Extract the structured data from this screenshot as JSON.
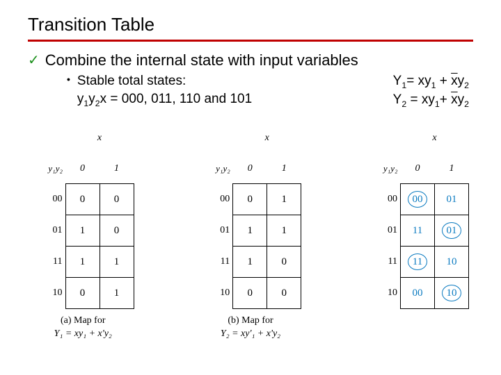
{
  "title": "Transition Table",
  "main_bullet": "Combine the internal state with input variables",
  "sub_bullet_line1": "Stable total states:",
  "sub_bullet_line2_prefix": "y",
  "sub_bullet_line2_sub1": "1",
  "sub_bullet_line2_mid": "y",
  "sub_bullet_line2_sub2": "2",
  "sub_bullet_line2_rest": "x = 000, 011, 110 and 101",
  "eq1_lhs": "Y",
  "eq1_sub": "1",
  "eq1_rhs_a": "= xy",
  "eq1_rhs_a_sub": "1",
  "eq1_plus": "+ ",
  "eq1_rhs_b_bar": "x",
  "eq1_rhs_b": "y",
  "eq1_rhs_b_sub": "2",
  "eq2_lhs": "Y",
  "eq2_sub": "2",
  "eq2_rhs_a": " = xy",
  "eq2_rhs_a_bar": "'",
  "eq2_rhs_a_sub": "1",
  "eq2_plus": "+ ",
  "eq2_rhs_b_bar": "x",
  "eq2_rhs_b": "y",
  "eq2_rhs_b_sub": "2",
  "top_var": "x",
  "side_var": "y₁y₂",
  "col0": "0",
  "col1": "1",
  "rows": [
    "00",
    "01",
    "11",
    "10"
  ],
  "mapA": {
    "r00": [
      "0",
      "0"
    ],
    "r01": [
      "1",
      "0"
    ],
    "r11": [
      "1",
      "1"
    ],
    "r10": [
      "0",
      "1"
    ]
  },
  "mapB": {
    "r00": [
      "0",
      "1"
    ],
    "r01": [
      "1",
      "1"
    ],
    "r11": [
      "1",
      "0"
    ],
    "r10": [
      "0",
      "0"
    ]
  },
  "mapC": {
    "r00": [
      "00",
      "01"
    ],
    "r01": [
      "11",
      "01"
    ],
    "r11": [
      "11",
      "10"
    ],
    "r10": [
      "00",
      "10"
    ]
  },
  "stableC": {
    "r00": [
      true,
      false
    ],
    "r01": [
      false,
      true
    ],
    "r11": [
      true,
      false
    ],
    "r10": [
      false,
      true
    ]
  },
  "captionA_l1": "(a) Map for",
  "captionA_l2": "Y₁ = xy₁ + x'y₂",
  "captionB_l1": "(b) Map for",
  "captionB_l2": "Y₂ = xy'₁ + x'y₂",
  "chart_data": [
    {
      "type": "table",
      "title": "Map for Y1 = xy1 + x'y2",
      "xlabel": "x",
      "ylabel": "y1y2",
      "categories_cols": [
        "0",
        "1"
      ],
      "categories_rows": [
        "00",
        "01",
        "11",
        "10"
      ],
      "values": [
        [
          0,
          0
        ],
        [
          1,
          0
        ],
        [
          1,
          1
        ],
        [
          0,
          1
        ]
      ]
    },
    {
      "type": "table",
      "title": "Map for Y2 = xy'1 + x'y2",
      "xlabel": "x",
      "ylabel": "y1y2",
      "categories_cols": [
        "0",
        "1"
      ],
      "categories_rows": [
        "00",
        "01",
        "11",
        "10"
      ],
      "values": [
        [
          0,
          1
        ],
        [
          1,
          1
        ],
        [
          1,
          0
        ],
        [
          0,
          0
        ]
      ]
    },
    {
      "type": "table",
      "title": "Transition table Y1Y2 (circled = stable)",
      "xlabel": "x",
      "ylabel": "y1y2",
      "categories_cols": [
        "0",
        "1"
      ],
      "categories_rows": [
        "00",
        "01",
        "11",
        "10"
      ],
      "values": [
        [
          "00",
          "01"
        ],
        [
          "11",
          "01"
        ],
        [
          "11",
          "10"
        ],
        [
          "00",
          "10"
        ]
      ],
      "stable": [
        [
          true,
          false
        ],
        [
          false,
          true
        ],
        [
          true,
          false
        ],
        [
          false,
          true
        ]
      ]
    }
  ]
}
